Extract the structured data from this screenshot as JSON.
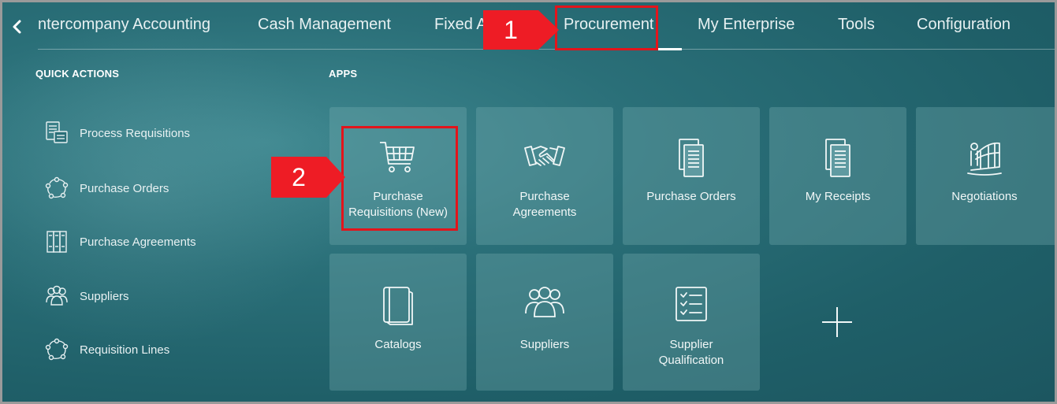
{
  "nav": {
    "back_icon": "chevron-left-icon",
    "tabs": [
      {
        "label": "ntercompany Accounting",
        "active": false
      },
      {
        "label": "Cash Management",
        "active": false
      },
      {
        "label": "Fixed A",
        "active": false
      },
      {
        "label": "Procurement",
        "active": true
      },
      {
        "label": "My Enterprise",
        "active": false
      },
      {
        "label": "Tools",
        "active": false
      },
      {
        "label": "Configuration",
        "active": false
      }
    ]
  },
  "quick_actions": {
    "heading": "QUICK ACTIONS",
    "items": [
      {
        "label": "Process Requisitions",
        "icon": "process-requisitions-icon"
      },
      {
        "label": "Purchase Orders",
        "icon": "cycle-icon"
      },
      {
        "label": "Purchase Agreements",
        "icon": "binders-icon"
      },
      {
        "label": "Suppliers",
        "icon": "people-group-icon"
      },
      {
        "label": "Requisition Lines",
        "icon": "cycle-icon"
      }
    ]
  },
  "apps": {
    "heading": "APPS",
    "tiles": [
      {
        "label": "Purchase Requisitions (New)",
        "line1": "Purchase",
        "line2": "Requisitions (New)",
        "icon": "shopping-cart-icon"
      },
      {
        "label": "Purchase Agreements",
        "line1": "Purchase",
        "line2": "Agreements",
        "icon": "handshake-icon"
      },
      {
        "label": "Purchase Orders",
        "line1": "Purchase Orders",
        "line2": "",
        "icon": "documents-icon"
      },
      {
        "label": "My Receipts",
        "line1": "My Receipts",
        "line2": "",
        "icon": "documents-icon"
      },
      {
        "label": "Negotiations",
        "line1": "Negotiations",
        "line2": "",
        "icon": "negotiations-icon"
      },
      {
        "label": "Catalogs",
        "line1": "Catalogs",
        "line2": "",
        "icon": "catalog-icon"
      },
      {
        "label": "Suppliers",
        "line1": "Suppliers",
        "line2": "",
        "icon": "people-group-icon"
      },
      {
        "label": "Supplier Qualification",
        "line1": "Supplier",
        "line2": "Qualification",
        "icon": "checklist-icon"
      }
    ],
    "add_icon": "plus-icon"
  },
  "callouts": [
    {
      "number": "1",
      "target": "Procurement"
    },
    {
      "number": "2",
      "target": "Purchase Requisitions (New)"
    }
  ],
  "colors": {
    "background": "#2a6f78",
    "tile": "#5f9aa1",
    "callout_red": "#ee1c25",
    "text": "#e8f1f2"
  }
}
